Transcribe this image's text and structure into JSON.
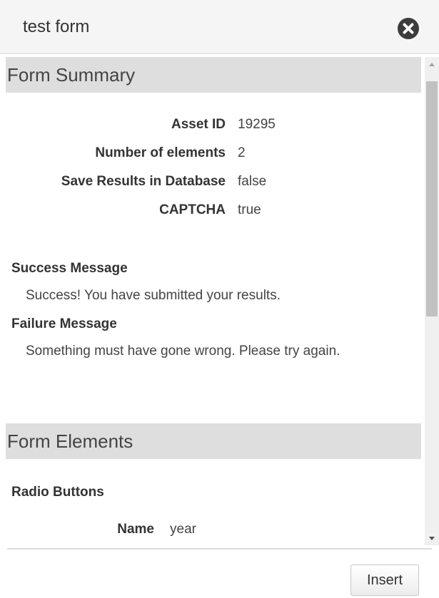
{
  "header": {
    "title": "test form"
  },
  "summary": {
    "heading": "Form Summary",
    "fields": [
      {
        "key": "Asset ID",
        "value": "19295"
      },
      {
        "key": "Number of elements",
        "value": "2"
      },
      {
        "key": "Save Results in Database",
        "value": "false"
      },
      {
        "key": "CAPTCHA",
        "value": "true"
      }
    ],
    "success_label": "Success Message",
    "success_text": "Success! You have submitted your results.",
    "failure_label": "Failure Message",
    "failure_text": "Something must have gone wrong. Please try again."
  },
  "elements": {
    "heading": "Form Elements",
    "items": [
      {
        "type": "Radio Buttons",
        "fields": [
          {
            "key": "Name",
            "value": "year"
          }
        ]
      }
    ]
  },
  "footer": {
    "insert_label": "Insert"
  },
  "icons": {
    "close": "close-icon",
    "scroll_up": "caret-up-icon",
    "scroll_down": "caret-down-icon"
  }
}
